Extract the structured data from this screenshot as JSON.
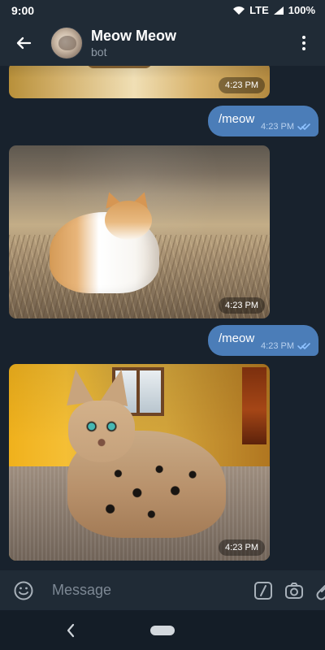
{
  "status_bar": {
    "time": "9:00",
    "network": "LTE",
    "battery": "100%",
    "icons": [
      "wifi-icon",
      "signal-icon",
      "battery-icon"
    ]
  },
  "header": {
    "title": "Meow Meow",
    "subtitle": "bot",
    "icons": {
      "back": "arrow-left-icon",
      "more": "more-vertical-icon"
    }
  },
  "messages": [
    {
      "type": "photo",
      "time": "4:23 PM"
    },
    {
      "type": "text",
      "text": "/meow",
      "time": "4:23 PM",
      "status_icon": "double-check-icon"
    },
    {
      "type": "photo",
      "time": "4:23 PM"
    },
    {
      "type": "text",
      "text": "/meow",
      "time": "4:23 PM",
      "status_icon": "double-check-icon"
    },
    {
      "type": "photo",
      "time": "4:23 PM"
    }
  ],
  "composer": {
    "placeholder": "Message",
    "icons": [
      "emoji-icon",
      "slash-command-icon",
      "camera-icon",
      "attachment-icon",
      "microphone-icon"
    ]
  },
  "colors": {
    "background": "#18222d",
    "header": "#202b36",
    "outgoing_bubble": "#4b7db8",
    "text_secondary": "#8f9aa6"
  }
}
